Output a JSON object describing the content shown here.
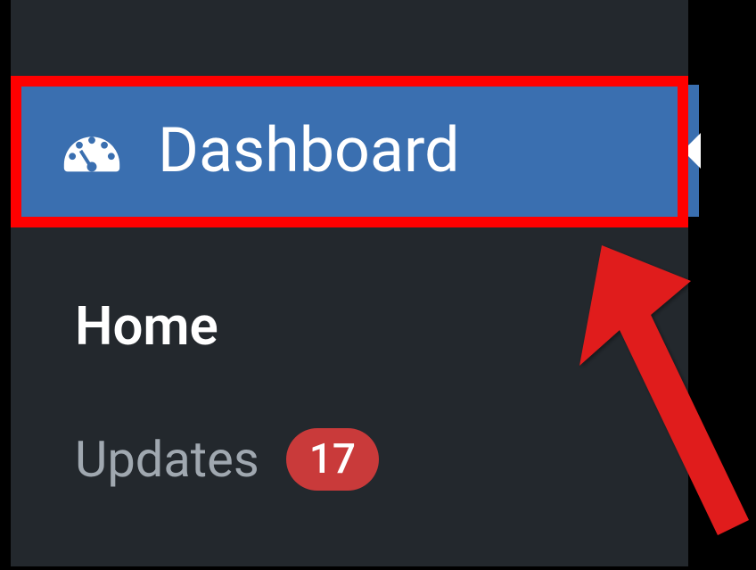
{
  "sidebar": {
    "dashboard": {
      "label": "Dashboard",
      "icon": "dashboard-gauge-icon"
    },
    "home": {
      "label": "Home"
    },
    "updates": {
      "label": "Updates",
      "badge_count": "17"
    }
  },
  "colors": {
    "highlight": "#ff0000",
    "active_bg": "#3a6fb0",
    "sidebar_bg": "#23282d",
    "badge_bg": "#c93a3a"
  }
}
